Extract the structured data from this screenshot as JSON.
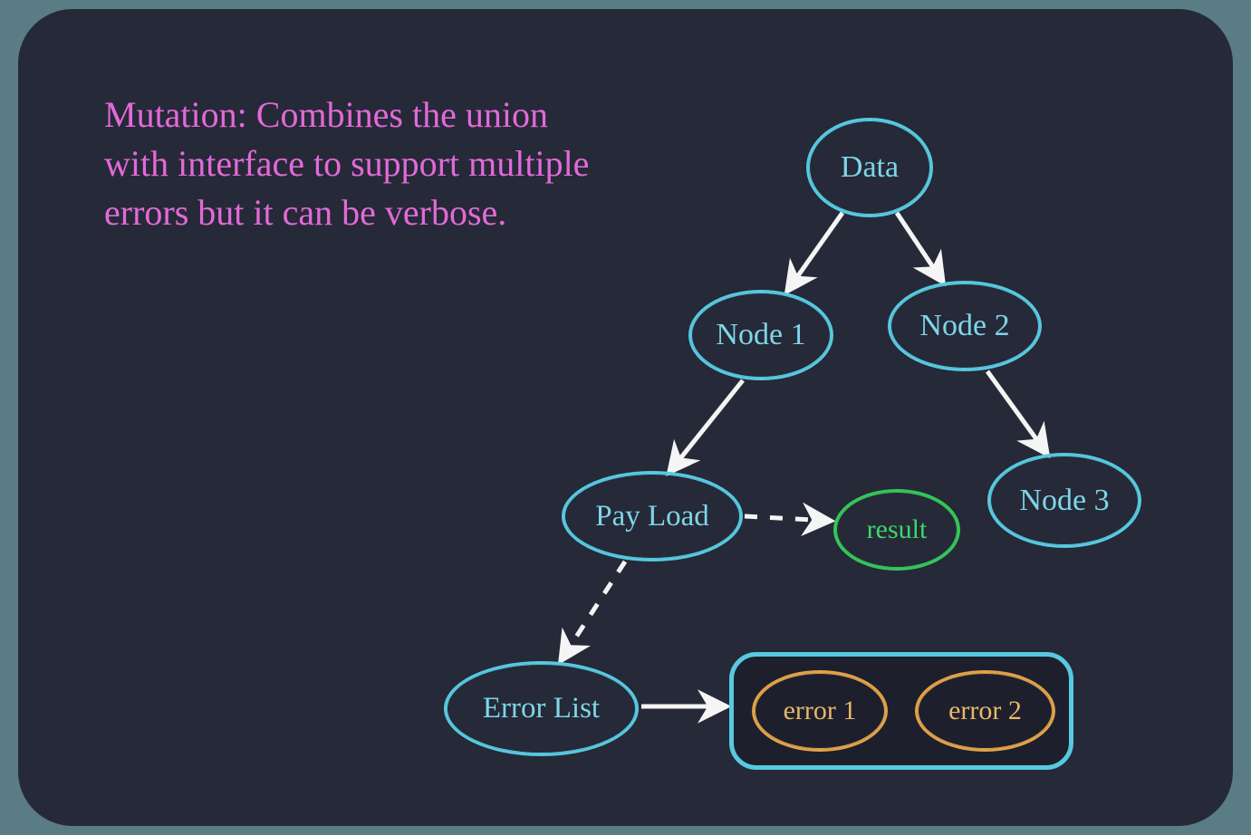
{
  "caption": "Mutation: Combines the union with interface to support multiple errors but it can be verbose.",
  "nodes": {
    "data": "Data",
    "node1": "Node 1",
    "node2": "Node 2",
    "payload": "Pay Load",
    "result": "result",
    "node3": "Node 3",
    "errorList": "Error List",
    "error1": "error 1",
    "error2": "error 2"
  },
  "edges": [
    {
      "from": "data",
      "to": "node1",
      "style": "solid"
    },
    {
      "from": "data",
      "to": "node2",
      "style": "solid"
    },
    {
      "from": "node1",
      "to": "payload",
      "style": "solid"
    },
    {
      "from": "node2",
      "to": "node3",
      "style": "solid"
    },
    {
      "from": "payload",
      "to": "result",
      "style": "dashed"
    },
    {
      "from": "payload",
      "to": "errorList",
      "style": "dashed"
    },
    {
      "from": "errorList",
      "to": "errorBox",
      "style": "solid"
    }
  ],
  "colors": {
    "background": "#262938",
    "caption": "#e26ad8",
    "blue": "#57c9e0",
    "green": "#34c759",
    "orange": "#e0a24a",
    "arrow": "#f5f5f5"
  }
}
